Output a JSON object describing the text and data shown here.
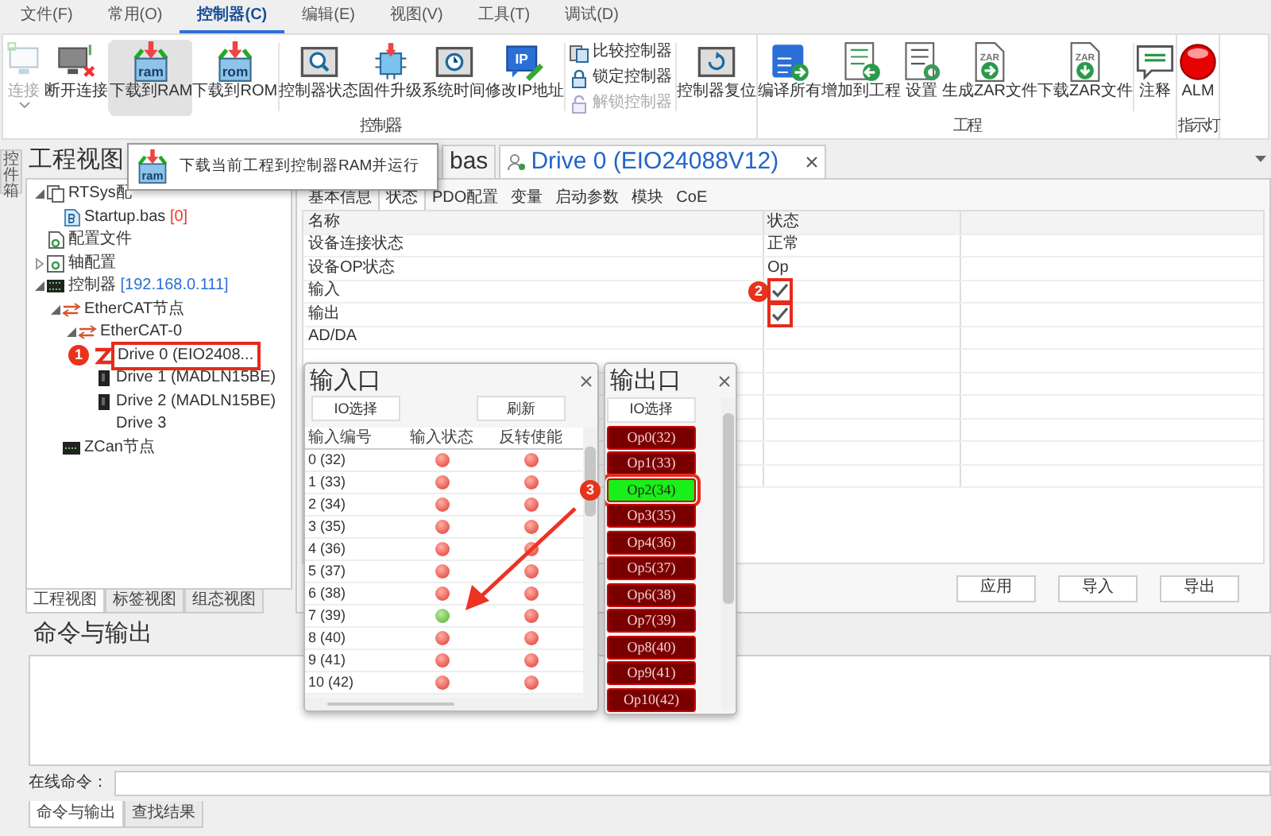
{
  "menu": [
    {
      "label": "文件(F)",
      "selected": false
    },
    {
      "label": "常用(O)",
      "selected": false
    },
    {
      "label": "控制器(C)",
      "selected": true
    },
    {
      "label": "编辑(E)",
      "selected": false
    },
    {
      "label": "视图(V)",
      "selected": false
    },
    {
      "label": "工具(T)",
      "selected": false
    },
    {
      "label": "调试(D)",
      "selected": false
    }
  ],
  "ribbon": [
    {
      "label": "控制器",
      "items": [
        {
          "kind": "large",
          "label": "连接",
          "disabled": true,
          "hovered": false,
          "dropdown": true
        },
        {
          "kind": "large",
          "label": "断开连接",
          "disabled": false,
          "hovered": false
        },
        {
          "kind": "separator"
        },
        {
          "kind": "large",
          "label": "下载到RAM",
          "icon_text": "ram",
          "disabled": false,
          "hovered": true
        },
        {
          "kind": "large",
          "label": "下载到ROM",
          "icon_text": "rom",
          "disabled": false,
          "hovered": false
        },
        {
          "kind": "separator"
        },
        {
          "kind": "large",
          "label": "控制器状态",
          "disabled": false,
          "hovered": false
        },
        {
          "kind": "large",
          "label": "固件升级",
          "disabled": false,
          "hovered": false
        },
        {
          "kind": "large",
          "label": "系统时间",
          "disabled": false,
          "hovered": false
        },
        {
          "kind": "large",
          "label": "修改IP地址",
          "icon_text": "IP",
          "disabled": false,
          "hovered": false
        },
        {
          "kind": "separator"
        },
        {
          "kind": "small",
          "label": "比较控制器",
          "disabled": false,
          "hovered": false
        },
        {
          "kind": "small",
          "label": "锁定控制器",
          "disabled": false,
          "hovered": false
        },
        {
          "kind": "small",
          "label": "解锁控制器",
          "disabled": true,
          "hovered": false
        },
        {
          "kind": "separator"
        },
        {
          "kind": "large",
          "label": "控制器复位",
          "disabled": false,
          "hovered": false
        }
      ]
    },
    {
      "label": "工程",
      "items": [
        {
          "kind": "large",
          "label": "编译所有",
          "disabled": false,
          "hovered": false
        },
        {
          "kind": "large",
          "label": "增加到工程",
          "disabled": false,
          "hovered": false
        },
        {
          "kind": "large",
          "label": "设置",
          "disabled": false,
          "hovered": false
        },
        {
          "kind": "large",
          "label": "生成ZAR文件",
          "icon_text": "ZAR",
          "disabled": false,
          "hovered": false
        },
        {
          "kind": "large",
          "label": "下载ZAR文件",
          "icon_text": "ZAR",
          "disabled": false,
          "hovered": false
        },
        {
          "kind": "separator"
        },
        {
          "kind": "large",
          "label": "注释",
          "disabled": false,
          "hovered": false
        }
      ]
    },
    {
      "label": "指示灯",
      "items": [
        {
          "kind": "large",
          "label": "ALM",
          "disabled": false,
          "hovered": false
        }
      ]
    }
  ],
  "tooltip": {
    "icon_text": "ram",
    "text": "下载当前工程到控制器RAM并运行"
  },
  "toolbox_tab": {
    "label": "控件箱"
  },
  "project_view": {
    "title": "工程视图",
    "tree": [
      {
        "kind": "group",
        "label": "RTSys配",
        "expanded": true,
        "children": [
          {
            "kind": "file",
            "label": "Startup.bas",
            "suffix": "[0]"
          }
        ]
      },
      {
        "kind": "config",
        "label": "配置文件"
      },
      {
        "kind": "axis",
        "label": "轴配置",
        "expanded": false
      },
      {
        "kind": "controller",
        "label": "控制器",
        "suffix": "[192.168.0.111]",
        "expanded": true,
        "children": [
          {
            "kind": "bus",
            "label": "EtherCAT节点",
            "expanded": true,
            "children": [
              {
                "kind": "bus",
                "label": "EtherCAT-0",
                "expanded": true,
                "children": [
                  {
                    "kind": "drive",
                    "label": "Drive 0 (EIO2408...",
                    "callout": "1"
                  },
                  {
                    "kind": "device",
                    "label": "Drive 1 (MADLN15BE)"
                  },
                  {
                    "kind": "device",
                    "label": "Drive 2 (MADLN15BE)"
                  },
                  {
                    "kind": "empty",
                    "label": "Drive 3"
                  }
                ]
              }
            ]
          },
          {
            "kind": "zcan",
            "label": "ZCan节点"
          }
        ]
      }
    ],
    "tabs": [
      {
        "label": "工程视图",
        "selected": true
      },
      {
        "label": "标签视图",
        "selected": false
      },
      {
        "label": "组态视图",
        "selected": false
      }
    ]
  },
  "documents": [
    {
      "label": "bas",
      "selected": false
    },
    {
      "label": "Drive 0 (EIO24088V12)",
      "selected": true
    }
  ],
  "device": {
    "tabs": [
      {
        "label": "基本信息",
        "selected": false
      },
      {
        "label": "状态",
        "selected": true
      },
      {
        "label": "PDO配置",
        "selected": false
      },
      {
        "label": "变量",
        "selected": false
      },
      {
        "label": "启动参数",
        "selected": false
      },
      {
        "label": "模块",
        "selected": false
      },
      {
        "label": "CoE",
        "selected": false
      }
    ],
    "columns": [
      "名称",
      "状态"
    ],
    "rows": [
      {
        "name": "设备连接状态",
        "kind": "text",
        "value": "正常"
      },
      {
        "name": "设备OP状态",
        "kind": "text",
        "value": "Op"
      },
      {
        "name": "输入",
        "kind": "check",
        "checked": true,
        "callout": "2"
      },
      {
        "name": "输出",
        "kind": "check",
        "checked": true
      },
      {
        "name": "AD/DA",
        "kind": "text"
      }
    ],
    "buttons": [
      "应用",
      "导入",
      "导出"
    ]
  },
  "input_window": {
    "title": "输入口",
    "buttons": [
      "IO选择",
      "刷新"
    ],
    "columns": [
      "输入编号",
      "输入状态",
      "反转使能"
    ],
    "rows": [
      {
        "label": "0 (32)",
        "on": false,
        "invert": false
      },
      {
        "label": "1 (33)",
        "on": false,
        "invert": false
      },
      {
        "label": "2 (34)",
        "on": false,
        "invert": false
      },
      {
        "label": "3 (35)",
        "on": false,
        "invert": false
      },
      {
        "label": "4 (36)",
        "on": false,
        "invert": false
      },
      {
        "label": "5 (37)",
        "on": false,
        "invert": false
      },
      {
        "label": "6 (38)",
        "on": false,
        "invert": false
      },
      {
        "label": "7 (39)",
        "on": true,
        "invert": false
      },
      {
        "label": "8 (40)",
        "on": false,
        "invert": false
      },
      {
        "label": "9 (41)",
        "on": false,
        "invert": false
      },
      {
        "label": "10 (42)",
        "on": false,
        "invert": false
      }
    ]
  },
  "output_window": {
    "title": "输出口",
    "button": "IO选择",
    "outputs": [
      {
        "label": "Op0(32)",
        "on": false
      },
      {
        "label": "Op1(33)",
        "on": false
      },
      {
        "label": "Op2(34)",
        "on": true,
        "callout": "3"
      },
      {
        "label": "Op3(35)",
        "on": false
      },
      {
        "label": "Op4(36)",
        "on": false
      },
      {
        "label": "Op5(37)",
        "on": false
      },
      {
        "label": "Op6(38)",
        "on": false
      },
      {
        "label": "Op7(39)",
        "on": false
      },
      {
        "label": "Op8(40)",
        "on": false
      },
      {
        "label": "Op9(41)",
        "on": false
      },
      {
        "label": "Op10(42)",
        "on": false
      }
    ]
  },
  "command_panel": {
    "title": "命令与输出",
    "input_label": "在线命令：",
    "tabs": [
      {
        "label": "命令与输出",
        "selected": true
      },
      {
        "label": "查找结果",
        "selected": false
      }
    ]
  }
}
